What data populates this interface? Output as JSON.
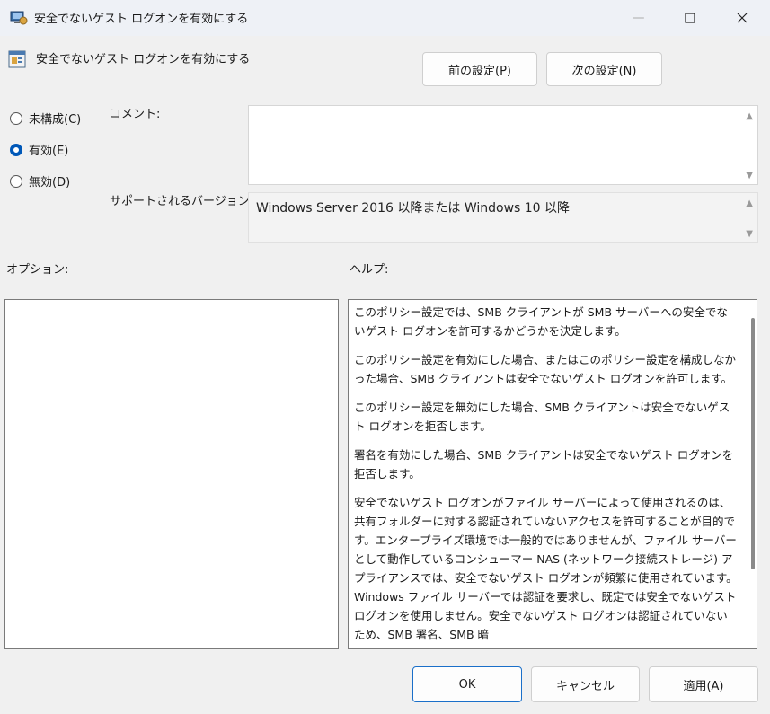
{
  "window": {
    "title": "安全でないゲスト ログオンを有効にする",
    "controls": {
      "minimize": "—",
      "maximize": "☐",
      "close": "✕"
    }
  },
  "policy": {
    "name": "安全でないゲスト ログオンを有効にする",
    "prev_button": "前の設定(P)",
    "next_button": "次の設定(N)"
  },
  "state": {
    "options": [
      {
        "label": "未構成(C)",
        "selected": false
      },
      {
        "label": "有効(E)",
        "selected": true
      },
      {
        "label": "無効(D)",
        "selected": false
      }
    ]
  },
  "comment": {
    "label": "コメント:",
    "value": ""
  },
  "supported": {
    "label": "サポートされるバージョン:",
    "value": "Windows Server 2016 以降または Windows 10 以降"
  },
  "options_panel": {
    "label": "オプション:"
  },
  "help_panel": {
    "label": "ヘルプ:",
    "paragraphs": [
      "このポリシー設定では、SMB クライアントが SMB サーバーへの安全でないゲスト ログオンを許可するかどうかを決定します。",
      "このポリシー設定を有効にした場合、またはこのポリシー設定を構成しなかった場合、SMB クライアントは安全でないゲスト ログオンを許可します。",
      "このポリシー設定を無効にした場合、SMB クライアントは安全でないゲスト ログオンを拒否します。",
      "署名を有効にした場合、SMB クライアントは安全でないゲスト ログオンを拒否します。",
      "安全でないゲスト ログオンがファイル サーバーによって使用されるのは、共有フォルダーに対する認証されていないアクセスを許可することが目的です。エンタープライズ環境では一般的ではありませんが、ファイル サーバーとして動作しているコンシューマー NAS (ネットワーク接続ストレージ) アプライアンスでは、安全でないゲスト ログオンが頻繁に使用されています。Windows ファイル サーバーでは認証を要求し、既定では安全でないゲスト ログオンを使用しません。安全でないゲスト ログオンは認証されていないため、SMB 署名、SMB 暗"
    ]
  },
  "footer": {
    "ok": "OK",
    "cancel": "キャンセル",
    "apply": "適用(A)"
  },
  "colors": {
    "accent": "#0058b8",
    "ok_border": "#1a6fc9"
  }
}
